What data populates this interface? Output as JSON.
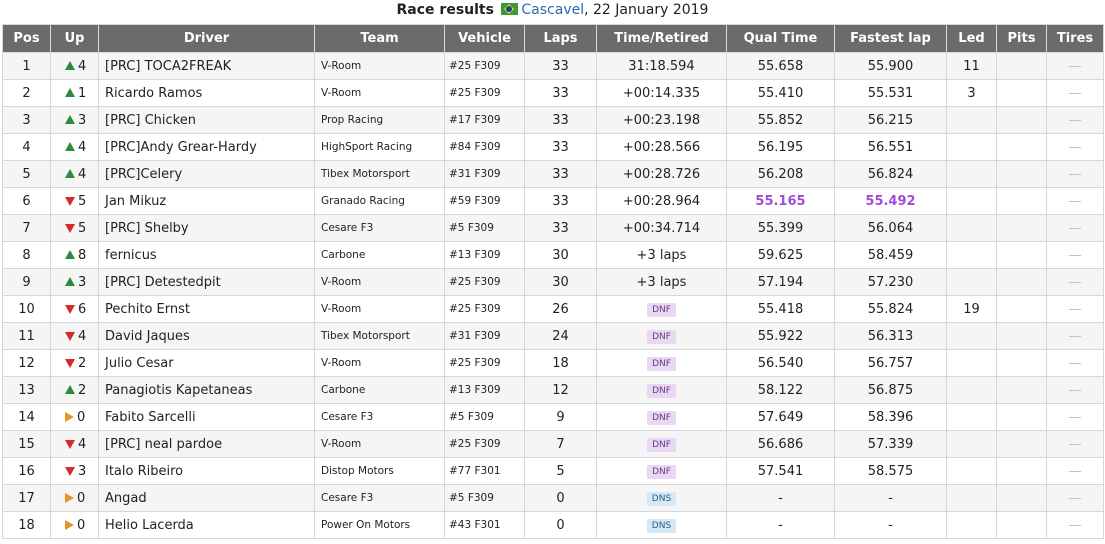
{
  "caption": {
    "title": "Race results",
    "flag_icon": "brazil-flag-icon",
    "location": "Cascavel",
    "date": ", 22 January 2019"
  },
  "columns": [
    "Pos",
    "Up",
    "Driver",
    "Team",
    "Vehicle",
    "Laps",
    "Time/Retired",
    "Qual Time",
    "Fastest lap",
    "Led",
    "Pits",
    "Tires"
  ],
  "colors": {
    "header_bg": "#6b6b6b",
    "up": "#2e8b3e",
    "down": "#d12b2b",
    "same": "#e8932a",
    "best": "#a24bd8",
    "dnf_bg": "#e8d8f2",
    "dns_bg": "#d5e8f5"
  },
  "rows": [
    {
      "pos": "1",
      "dir": "up",
      "up": "4",
      "driver": "[PRC] TOCA2FREAK",
      "team": "V-Room",
      "vehicle": "#25 F309",
      "laps": "33",
      "time": "31:18.594",
      "status": "",
      "qual": "55.658",
      "fastest": "55.900",
      "led": "11",
      "qual_best": false,
      "fast_best": false
    },
    {
      "pos": "2",
      "dir": "up",
      "up": "1",
      "driver": "Ricardo Ramos",
      "team": "V-Room",
      "vehicle": "#25 F309",
      "laps": "33",
      "time": "+00:14.335",
      "status": "",
      "qual": "55.410",
      "fastest": "55.531",
      "led": "3",
      "qual_best": false,
      "fast_best": false
    },
    {
      "pos": "3",
      "dir": "up",
      "up": "3",
      "driver": "[PRC] Chicken",
      "team": "Prop Racing",
      "vehicle": "#17 F309",
      "laps": "33",
      "time": "+00:23.198",
      "status": "",
      "qual": "55.852",
      "fastest": "56.215",
      "led": "",
      "qual_best": false,
      "fast_best": false
    },
    {
      "pos": "4",
      "dir": "up",
      "up": "4",
      "driver": "[PRC]Andy Grear-Hardy",
      "team": "HighSport Racing",
      "vehicle": "#84 F309",
      "laps": "33",
      "time": "+00:28.566",
      "status": "",
      "qual": "56.195",
      "fastest": "56.551",
      "led": "",
      "qual_best": false,
      "fast_best": false
    },
    {
      "pos": "5",
      "dir": "up",
      "up": "4",
      "driver": "[PRC]Celery",
      "team": "Tibex Motorsport",
      "vehicle": "#31 F309",
      "laps": "33",
      "time": "+00:28.726",
      "status": "",
      "qual": "56.208",
      "fastest": "56.824",
      "led": "",
      "qual_best": false,
      "fast_best": false
    },
    {
      "pos": "6",
      "dir": "down",
      "up": "5",
      "driver": "Jan Mikuz",
      "team": "Granado Racing",
      "vehicle": "#59 F309",
      "laps": "33",
      "time": "+00:28.964",
      "status": "",
      "qual": "55.165",
      "fastest": "55.492",
      "led": "",
      "qual_best": true,
      "fast_best": true
    },
    {
      "pos": "7",
      "dir": "down",
      "up": "5",
      "driver": "[PRC] Shelby",
      "team": "Cesare F3",
      "vehicle": "#5 F309",
      "laps": "33",
      "time": "+00:34.714",
      "status": "",
      "qual": "55.399",
      "fastest": "56.064",
      "led": "",
      "qual_best": false,
      "fast_best": false
    },
    {
      "pos": "8",
      "dir": "up",
      "up": "8",
      "driver": "fernicus",
      "team": "Carbone",
      "vehicle": "#13 F309",
      "laps": "30",
      "time": "+3 laps",
      "status": "",
      "qual": "59.625",
      "fastest": "58.459",
      "led": "",
      "qual_best": false,
      "fast_best": false
    },
    {
      "pos": "9",
      "dir": "up",
      "up": "3",
      "driver": "[PRC] Detestedpit",
      "team": "V-Room",
      "vehicle": "#25 F309",
      "laps": "30",
      "time": "+3 laps",
      "status": "",
      "qual": "57.194",
      "fastest": "57.230",
      "led": "",
      "qual_best": false,
      "fast_best": false
    },
    {
      "pos": "10",
      "dir": "down",
      "up": "6",
      "driver": "Pechito Ernst",
      "team": "V-Room",
      "vehicle": "#25 F309",
      "laps": "26",
      "time": "",
      "status": "DNF",
      "qual": "55.418",
      "fastest": "55.824",
      "led": "19",
      "qual_best": false,
      "fast_best": false
    },
    {
      "pos": "11",
      "dir": "down",
      "up": "4",
      "driver": "David Jaques",
      "team": "Tibex Motorsport",
      "vehicle": "#31 F309",
      "laps": "24",
      "time": "",
      "status": "DNF",
      "qual": "55.922",
      "fastest": "56.313",
      "led": "",
      "qual_best": false,
      "fast_best": false
    },
    {
      "pos": "12",
      "dir": "down",
      "up": "2",
      "driver": "Julio Cesar",
      "team": "V-Room",
      "vehicle": "#25 F309",
      "laps": "18",
      "time": "",
      "status": "DNF",
      "qual": "56.540",
      "fastest": "56.757",
      "led": "",
      "qual_best": false,
      "fast_best": false
    },
    {
      "pos": "13",
      "dir": "up",
      "up": "2",
      "driver": "Panagiotis Kapetaneas",
      "team": "Carbone",
      "vehicle": "#13 F309",
      "laps": "12",
      "time": "",
      "status": "DNF",
      "qual": "58.122",
      "fastest": "56.875",
      "led": "",
      "qual_best": false,
      "fast_best": false
    },
    {
      "pos": "14",
      "dir": "same",
      "up": "0",
      "driver": "Fabito Sarcelli",
      "team": "Cesare F3",
      "vehicle": "#5 F309",
      "laps": "9",
      "time": "",
      "status": "DNF",
      "qual": "57.649",
      "fastest": "58.396",
      "led": "",
      "qual_best": false,
      "fast_best": false
    },
    {
      "pos": "15",
      "dir": "down",
      "up": "4",
      "driver": "[PRC] neal pardoe",
      "team": "V-Room",
      "vehicle": "#25 F309",
      "laps": "7",
      "time": "",
      "status": "DNF",
      "qual": "56.686",
      "fastest": "57.339",
      "led": "",
      "qual_best": false,
      "fast_best": false
    },
    {
      "pos": "16",
      "dir": "down",
      "up": "3",
      "driver": "Italo Ribeiro",
      "team": "Distop Motors",
      "vehicle": "#77 F301",
      "laps": "5",
      "time": "",
      "status": "DNF",
      "qual": "57.541",
      "fastest": "58.575",
      "led": "",
      "qual_best": false,
      "fast_best": false
    },
    {
      "pos": "17",
      "dir": "same",
      "up": "0",
      "driver": "Angad",
      "team": "Cesare F3",
      "vehicle": "#5 F309",
      "laps": "0",
      "time": "",
      "status": "DNS",
      "qual": "-",
      "fastest": "-",
      "led": "",
      "qual_best": false,
      "fast_best": false
    },
    {
      "pos": "18",
      "dir": "same",
      "up": "0",
      "driver": "Helio Lacerda",
      "team": "Power On Motors",
      "vehicle": "#43 F301",
      "laps": "0",
      "time": "",
      "status": "DNS",
      "qual": "-",
      "fastest": "-",
      "led": "",
      "qual_best": false,
      "fast_best": false
    }
  ]
}
